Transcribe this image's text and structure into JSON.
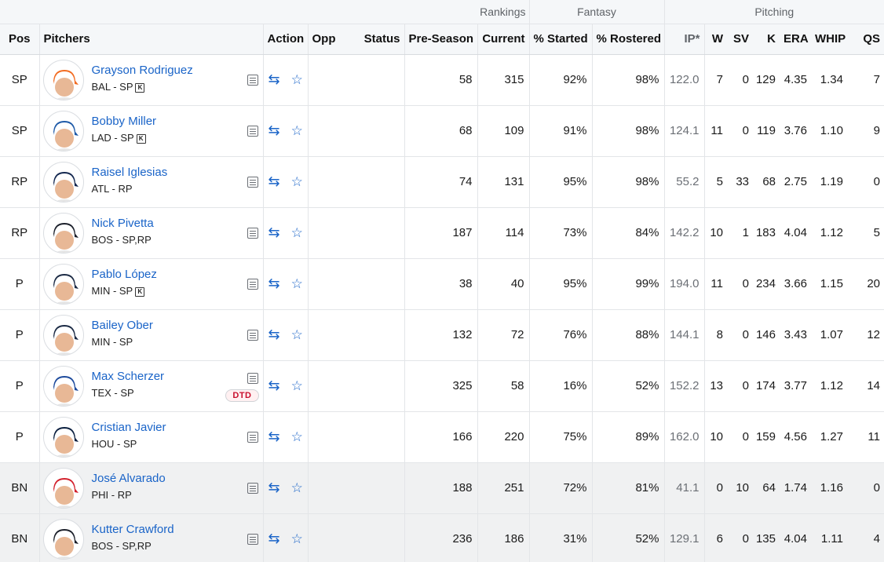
{
  "groups": {
    "rankings": "Rankings",
    "fantasy": "Fantasy",
    "pitching": "Pitching"
  },
  "headers": {
    "pos": "Pos",
    "pitchers": "Pitchers",
    "action": "Action",
    "opp": "Opp",
    "status": "Status",
    "preseason": "Pre-Season",
    "current": "Current",
    "started": "% Started",
    "rostered": "% Rostered",
    "ip": "IP*",
    "w": "W",
    "sv": "SV",
    "k": "K",
    "era": "ERA",
    "whip": "WHIP",
    "qs": "QS"
  },
  "colors": {
    "link": "#1a64c8",
    "dtd": "#c8102e",
    "bench_row": "#f0f1f2"
  },
  "icons": {
    "notes": "notes-icon",
    "trade": "trade-arrows-icon",
    "watch": "star-outline-icon"
  },
  "players": [
    {
      "pos": "SP",
      "name": "Grayson Rodriguez",
      "team_pos": "BAL - SP",
      "k_badge": true,
      "status_badge": "",
      "preseason": "58",
      "current": "315",
      "started": "92%",
      "rostered": "98%",
      "ip": "122.0",
      "w": "7",
      "sv": "0",
      "k": "129",
      "era": "4.35",
      "whip": "1.34",
      "qs": "7",
      "cap": "#f26c22"
    },
    {
      "pos": "SP",
      "name": "Bobby Miller",
      "team_pos": "LAD - SP",
      "k_badge": true,
      "status_badge": "",
      "preseason": "68",
      "current": "109",
      "started": "91%",
      "rostered": "98%",
      "ip": "124.1",
      "w": "11",
      "sv": "0",
      "k": "119",
      "era": "3.76",
      "whip": "1.10",
      "qs": "9",
      "cap": "#1e5aa8"
    },
    {
      "pos": "RP",
      "name": "Raisel Iglesias",
      "team_pos": "ATL - RP",
      "k_badge": false,
      "status_badge": "",
      "preseason": "74",
      "current": "131",
      "started": "95%",
      "rostered": "98%",
      "ip": "55.2",
      "w": "5",
      "sv": "33",
      "k": "68",
      "era": "2.75",
      "whip": "1.19",
      "qs": "0",
      "cap": "#13274f"
    },
    {
      "pos": "RP",
      "name": "Nick Pivetta",
      "team_pos": "BOS - SP,RP",
      "k_badge": false,
      "status_badge": "",
      "preseason": "187",
      "current": "114",
      "started": "73%",
      "rostered": "84%",
      "ip": "142.2",
      "w": "10",
      "sv": "1",
      "k": "183",
      "era": "4.04",
      "whip": "1.12",
      "qs": "5",
      "cap": "#1b1f2a"
    },
    {
      "pos": "P",
      "name": "Pablo López",
      "team_pos": "MIN - SP",
      "k_badge": true,
      "status_badge": "",
      "preseason": "38",
      "current": "40",
      "started": "95%",
      "rostered": "99%",
      "ip": "194.0",
      "w": "11",
      "sv": "0",
      "k": "234",
      "era": "3.66",
      "whip": "1.15",
      "qs": "20",
      "cap": "#1b2a44"
    },
    {
      "pos": "P",
      "name": "Bailey Ober",
      "team_pos": "MIN - SP",
      "k_badge": false,
      "status_badge": "",
      "preseason": "132",
      "current": "72",
      "started": "76%",
      "rostered": "88%",
      "ip": "144.1",
      "w": "8",
      "sv": "0",
      "k": "146",
      "era": "3.43",
      "whip": "1.07",
      "qs": "12",
      "cap": "#1b2a44"
    },
    {
      "pos": "P",
      "name": "Max Scherzer",
      "team_pos": "TEX - SP",
      "k_badge": false,
      "status_badge": "DTD",
      "preseason": "325",
      "current": "58",
      "started": "16%",
      "rostered": "52%",
      "ip": "152.2",
      "w": "13",
      "sv": "0",
      "k": "174",
      "era": "3.77",
      "whip": "1.12",
      "qs": "14",
      "cap": "#1d4a9c"
    },
    {
      "pos": "P",
      "name": "Cristian Javier",
      "team_pos": "HOU - SP",
      "k_badge": false,
      "status_badge": "",
      "preseason": "166",
      "current": "220",
      "started": "75%",
      "rostered": "89%",
      "ip": "162.0",
      "w": "10",
      "sv": "0",
      "k": "159",
      "era": "4.56",
      "whip": "1.27",
      "qs": "11",
      "cap": "#0b1f3f"
    },
    {
      "pos": "BN",
      "name": "José Alvarado",
      "team_pos": "PHI - RP",
      "k_badge": false,
      "status_badge": "",
      "preseason": "188",
      "current": "251",
      "started": "72%",
      "rostered": "81%",
      "ip": "41.1",
      "w": "0",
      "sv": "10",
      "k": "64",
      "era": "1.74",
      "whip": "1.16",
      "qs": "0",
      "cap": "#d3212d"
    },
    {
      "pos": "BN",
      "name": "Kutter Crawford",
      "team_pos": "BOS - SP,RP",
      "k_badge": false,
      "status_badge": "",
      "preseason": "236",
      "current": "186",
      "started": "31%",
      "rostered": "52%",
      "ip": "129.1",
      "w": "6",
      "sv": "0",
      "k": "135",
      "era": "4.04",
      "whip": "1.11",
      "qs": "4",
      "cap": "#1b1f2a"
    }
  ]
}
